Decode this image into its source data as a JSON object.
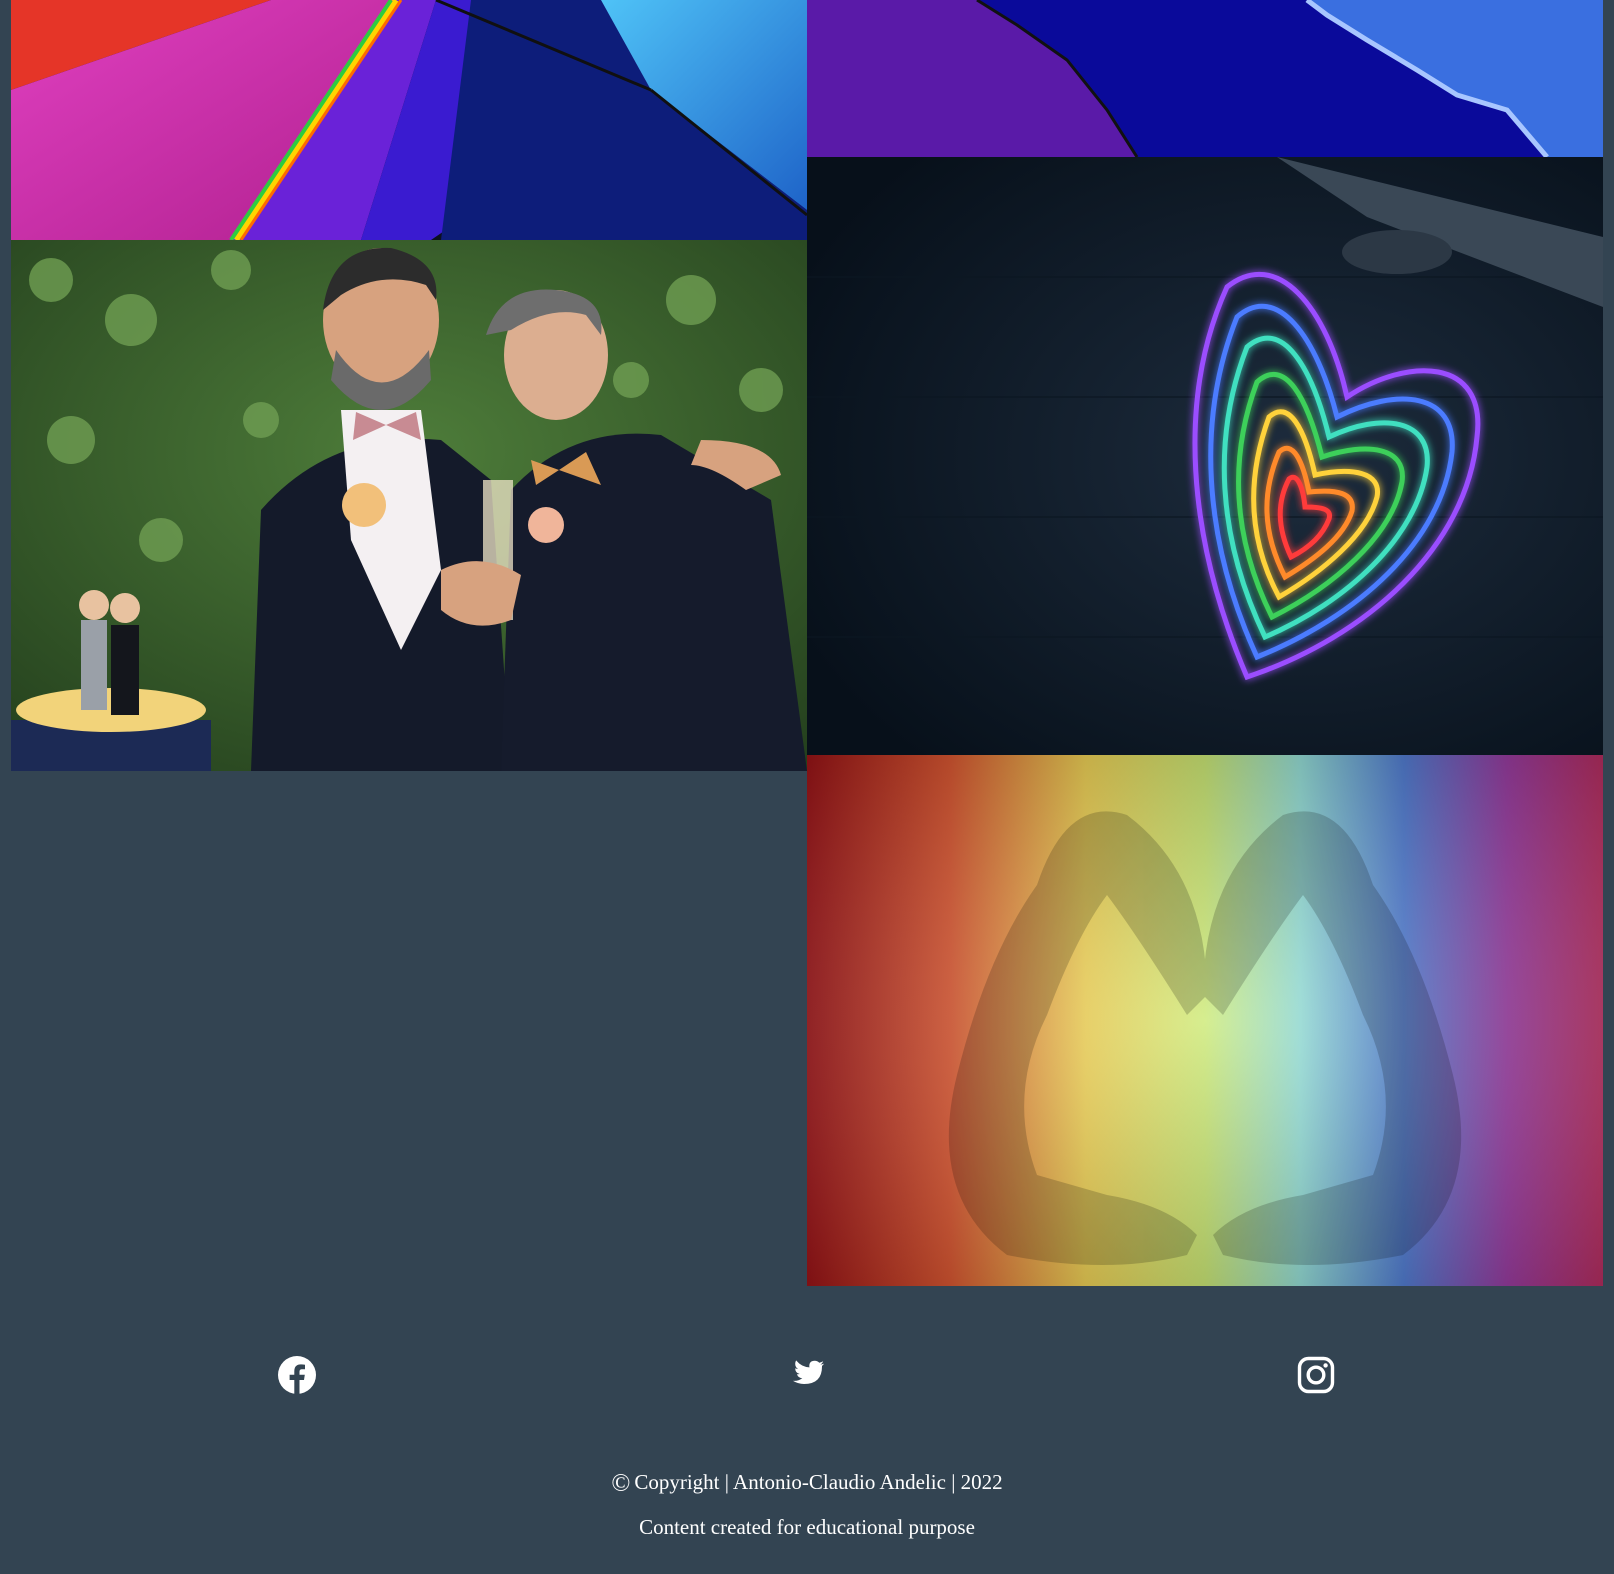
{
  "gallery": {
    "images": [
      {
        "name": "rainbow-umbrella",
        "icon": "umbrella-photo"
      },
      {
        "name": "torn-paper",
        "icon": "paper-photo"
      },
      {
        "name": "wedding-couple",
        "icon": "couple-photo"
      },
      {
        "name": "neon-heart",
        "icon": "neon-heart-photo"
      },
      {
        "name": "rainbow-hands-heart",
        "icon": "hands-heart-photo"
      }
    ]
  },
  "social": {
    "links": [
      {
        "name": "facebook",
        "icon": "facebook-icon"
      },
      {
        "name": "twitter",
        "icon": "twitter-icon"
      },
      {
        "name": "instagram",
        "icon": "instagram-icon"
      }
    ]
  },
  "footer": {
    "copyright_symbol": "©",
    "copyright_text": "Copyright | Antonio-Claudio Andelic | 2022",
    "purpose_text": "Content created for educational purpose"
  },
  "colors": {
    "background": "#334452",
    "text": "#ffffff"
  }
}
